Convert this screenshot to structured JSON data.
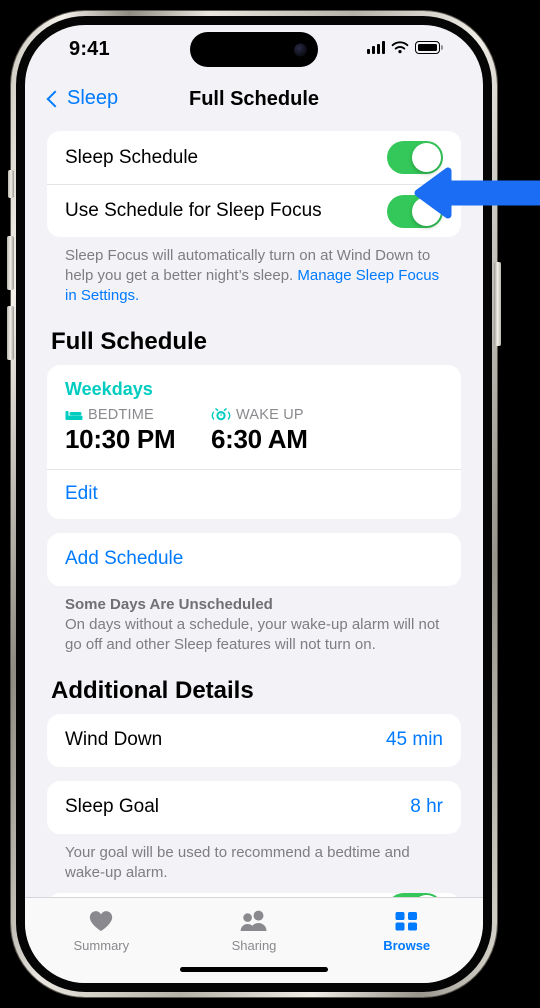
{
  "status_bar": {
    "time": "9:41",
    "cellular_icon": "cellular-bars-icon",
    "wifi_icon": "wifi-icon",
    "battery_icon": "battery-full-icon"
  },
  "nav": {
    "back_label": "Sleep",
    "back_icon": "chevron-left-icon",
    "title": "Full Schedule"
  },
  "schedule_toggles": {
    "rows": [
      {
        "label": "Sleep Schedule",
        "state": "on"
      },
      {
        "label": "Use Schedule for Sleep Focus",
        "state": "on"
      }
    ],
    "footnote_text": "Sleep Focus will automatically turn on at Wind Down to help you get a better night’s sleep. ",
    "footnote_link": "Manage Sleep Focus in Settings."
  },
  "full_schedule": {
    "section_title": "Full Schedule",
    "schedule": {
      "days_label": "Weekdays",
      "bedtime_icon": "bed-icon",
      "bedtime_label": "BEDTIME",
      "bedtime_value": "10:30 PM",
      "wakeup_icon": "alarm-clock-icon",
      "wakeup_label": "WAKE UP",
      "wakeup_value": "6:30 AM"
    },
    "edit_label": "Edit",
    "add_schedule_label": "Add Schedule",
    "footnote_title": "Some Days Are Unscheduled",
    "footnote_text": "On days without a schedule, your wake-up alarm will not go off and other Sleep features will not turn on."
  },
  "additional_details": {
    "section_title": "Additional Details",
    "wind_down": {
      "label": "Wind Down",
      "value": "45 min"
    },
    "sleep_goal": {
      "label": "Sleep Goal",
      "value": "8 hr"
    },
    "sleep_goal_footnote": "Your goal will be used to recommend a bedtime and wake-up alarm."
  },
  "tab_bar": {
    "tabs": [
      {
        "label": "Summary",
        "icon": "heart-icon",
        "active": false
      },
      {
        "label": "Sharing",
        "icon": "people-icon",
        "active": false
      },
      {
        "label": "Browse",
        "icon": "grid-icon",
        "active": true
      }
    ]
  },
  "annotation": {
    "arrow_icon": "left-arrow-annotation",
    "color": "#1b6ef3"
  },
  "colors": {
    "accent_blue": "#007aff",
    "toggle_green": "#34c759",
    "teal": "#00cdc0",
    "background": "#f2f2f7",
    "card": "#ffffff"
  }
}
